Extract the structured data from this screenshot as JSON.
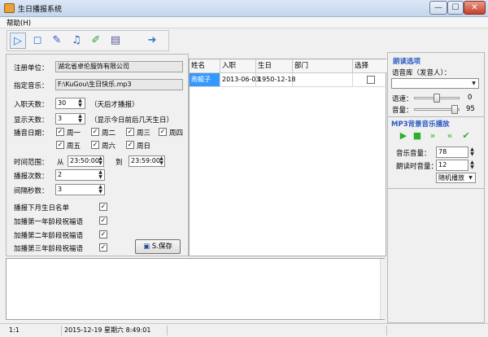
{
  "window": {
    "title": "生日播报系统",
    "min_glyph": "—",
    "max_glyph": "☐",
    "close_glyph": "✕"
  },
  "menu": {
    "help": "帮助(H)"
  },
  "toolbar": {
    "buttons": [
      {
        "name": "play-icon",
        "glyph": "▷",
        "color": "#2a7ad0"
      },
      {
        "name": "stop-icon",
        "glyph": "◻",
        "color": "#2a7ad0"
      },
      {
        "name": "edit-icon",
        "glyph": "✎",
        "color": "#2a59c2"
      },
      {
        "name": "music-icon",
        "glyph": "♫",
        "color": "#2a59c2"
      },
      {
        "name": "pen-icon",
        "glyph": "✐",
        "color": "#2da33a"
      },
      {
        "name": "notepad-icon",
        "glyph": "▤",
        "color": "#5a5a9a"
      },
      {
        "name": "exit-icon",
        "glyph": "➜",
        "color": "#2a7ad0"
      }
    ]
  },
  "form": {
    "unit_label": "注册单位：",
    "unit_value": "湖北省卓伦服饰有限公司",
    "music_label": "指定音乐：",
    "music_value": "F:\\KuGou\\生日快乐.mp3",
    "entry_days_label": "入职天数：",
    "entry_days_value": "30",
    "entry_days_hint": "（天后才播报）",
    "show_days_label": "显示天数：",
    "show_days_value": "3",
    "show_days_hint": "（显示今日前后几天生日）",
    "date_label": "播音日期：",
    "weekdays": [
      "周一",
      "周二",
      "周三",
      "周四",
      "周五",
      "周六",
      "周日"
    ],
    "time_label": "时间范围：",
    "time_from_label": "从",
    "time_from": "23:50:00",
    "time_to_label": "到",
    "time_to": "23:59:00",
    "count_label": "播报次数：",
    "count_value": "2",
    "interval_label": "间隔秒数：",
    "interval_value": "3",
    "options": [
      {
        "label": "播报下月生日名单",
        "checked": true
      },
      {
        "label": "加播第一年龄段祝福语",
        "checked": true
      },
      {
        "label": "加播第二年龄段祝福语",
        "checked": true
      },
      {
        "label": "加播第三年龄段祝福语",
        "checked": true
      }
    ],
    "save_label": "S.保存"
  },
  "grid": {
    "headers": [
      "姓名",
      "入职",
      "生日",
      "部门",
      "选择"
    ],
    "rows": [
      {
        "name": "燕鲲子",
        "join": "2013-06-03",
        "birthday": "1950-12-18",
        "dept": "",
        "selected": false
      }
    ]
  },
  "reading": {
    "title": "朗读选项",
    "voice_label": "语音库（发音人）：",
    "voice_value": "",
    "speed_label": "语速：",
    "speed_value": "0",
    "volume_label": "音量：",
    "volume_value": "95",
    "speed_level": 0.5,
    "volume_level": 0.95
  },
  "mp3": {
    "title": "MP3背景音乐播放",
    "buttons": [
      {
        "name": "mp3-play-icon",
        "glyph": "▶"
      },
      {
        "name": "mp3-stop-icon",
        "glyph": "■"
      },
      {
        "name": "mp3-next-icon",
        "glyph": "»"
      },
      {
        "name": "mp3-prev-icon",
        "glyph": "«"
      },
      {
        "name": "mp3-check-icon",
        "glyph": "✔"
      }
    ],
    "music_volume_label": "音乐音量：",
    "music_volume_value": "78",
    "read_volume_label": "朗读时音量：",
    "read_volume_value": "12",
    "play_mode": "随机播放"
  },
  "status": {
    "position": "1:1",
    "datetime": "2015-12-19 星期六 8:49:01"
  }
}
